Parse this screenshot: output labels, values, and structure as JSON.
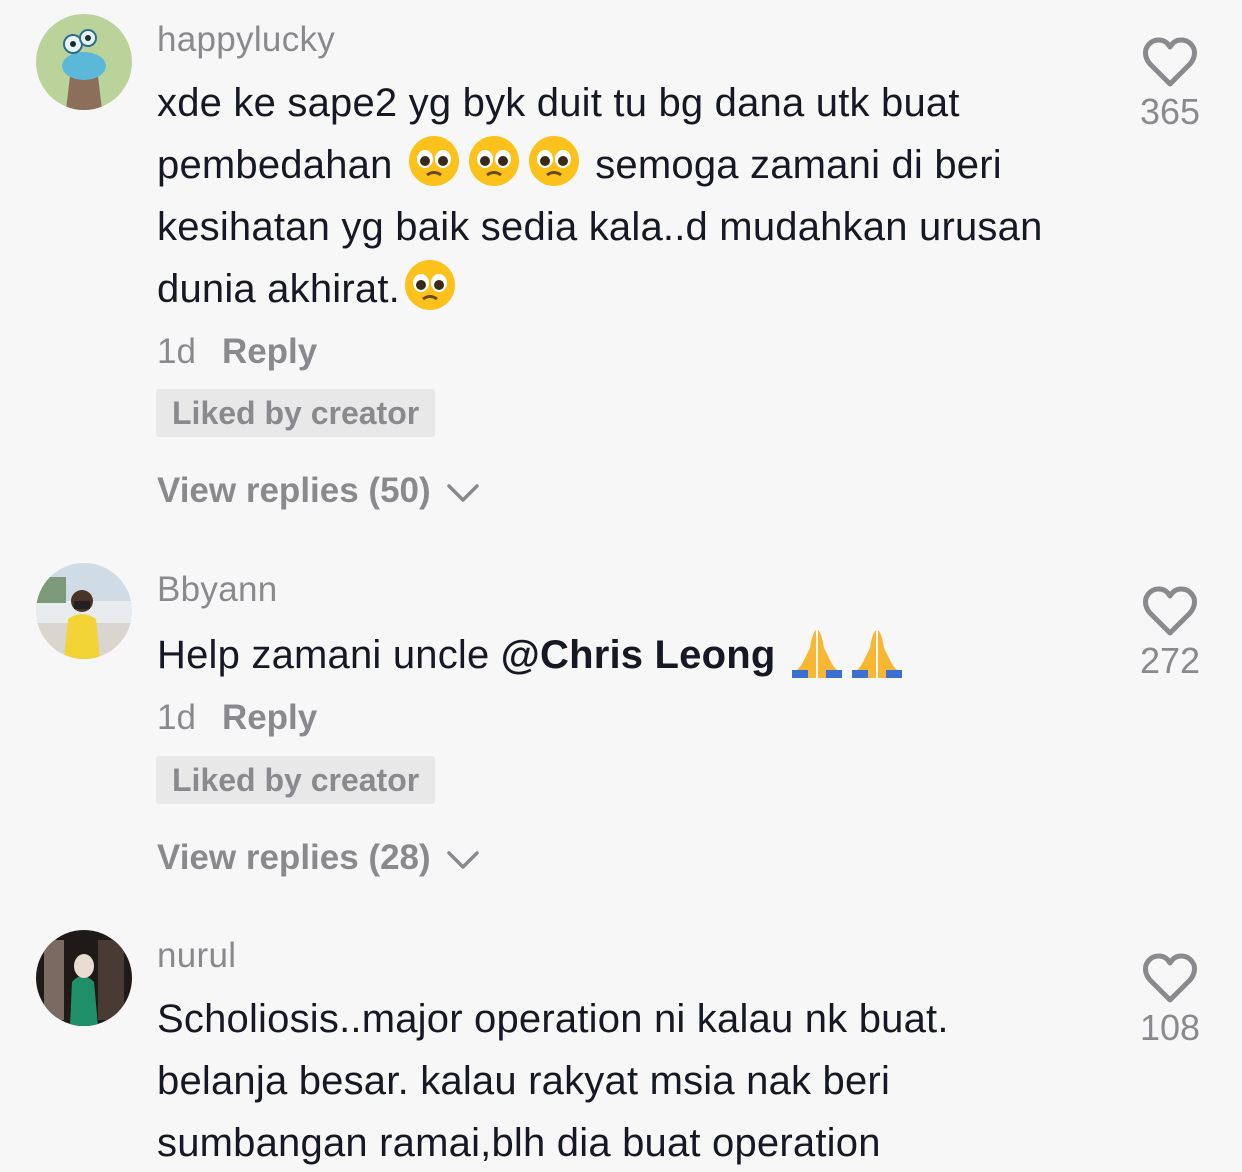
{
  "comments": [
    {
      "username": "happylucky",
      "text": {
        "part1": "xde ke sape2 yg byk duit tu bg dana utk buat pembedahan",
        "part2": "semoga zamani di beri kesihatan yg baik sedia kala..d mudahkan urusan dunia akhirat."
      },
      "emoji_main": "pleading-face-emoji",
      "time": "1d",
      "reply_label": "Reply",
      "liked_badge": "Liked by creator",
      "view_replies": "View replies (50)",
      "like_count": "365"
    },
    {
      "username": "Bbyann",
      "text": {
        "part1": "Help zamani uncle ",
        "mention": "@Chris Leong"
      },
      "emoji_main": "folded-hands-emoji",
      "time": "1d",
      "reply_label": "Reply",
      "liked_badge": "Liked by creator",
      "view_replies": "View replies (28)",
      "like_count": "272"
    },
    {
      "username": "nurul",
      "text": {
        "part1": "Scholiosis..major operation ni kalau nk buat. belanja besar. kalau rakyat msia nak beri sumbangan ramai,blh dia buat operation"
      },
      "time": "",
      "like_count": "108"
    }
  ],
  "icons": {
    "heart": "heart-outline-icon",
    "chevron": "chevron-down-icon"
  },
  "colors": {
    "background": "#f8f7f7",
    "text_primary": "#161823",
    "text_secondary": "#8a8a8e",
    "badge_bg": "#e9e8e8"
  }
}
